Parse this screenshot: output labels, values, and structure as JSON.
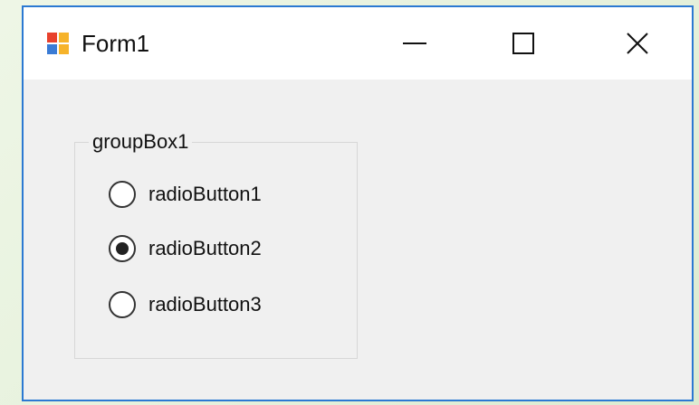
{
  "window": {
    "title": "Form1",
    "accent_color": "#2b79d2",
    "controls": {
      "minimize_icon": "minimize-icon",
      "maximize_icon": "maximize-icon",
      "close_icon": "close-icon"
    }
  },
  "groupbox": {
    "title": "groupBox1",
    "radio_buttons": [
      {
        "label": "radioButton1",
        "checked": false
      },
      {
        "label": "radioButton2",
        "checked": true
      },
      {
        "label": "radioButton3",
        "checked": false
      }
    ]
  }
}
